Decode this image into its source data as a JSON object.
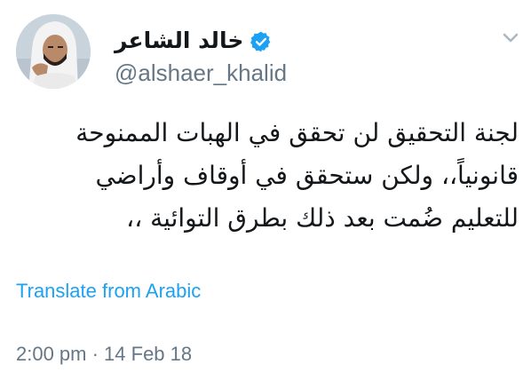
{
  "author": {
    "display_name": "خالد الشاعر",
    "handle": "@alshaer_khalid",
    "verified": true
  },
  "tweet": {
    "text": "لجنة التحقيق لن تحقق في الهبات الممنوحة\nقانونياً،، ولكن ستحقق في أوقاف وأراضي\nللتعليم ضُمت بعد ذلك بطرق التوائية ،،",
    "translate_label": "Translate from Arabic",
    "timestamp": "2:00 pm · 14 Feb 18"
  },
  "icons": {
    "verified": "verified-badge-icon",
    "menu": "chevron-down-icon"
  },
  "colors": {
    "link": "#1da1f2",
    "secondary_text": "#657786",
    "primary_text": "#14171a"
  }
}
